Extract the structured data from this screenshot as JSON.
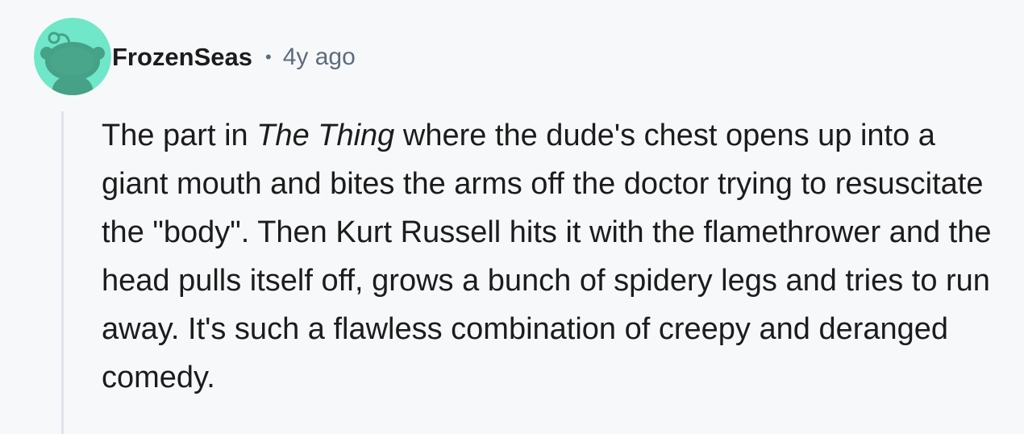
{
  "comment": {
    "author": "FrozenSeas",
    "separator": "•",
    "timestamp": "4y ago",
    "avatar": {
      "icon": "snoo-avatar-icon",
      "background_color": "#6fe7c8",
      "figure_color": "#46a186"
    },
    "body": {
      "prefix": "The part in ",
      "emphasis": "The Thing",
      "text": " where the dude's chest opens up into a giant mouth and bites the arms off the doctor trying to resuscitate the \"body\". Then Kurt Russell hits it with the flamethrower and the head pulls itself off, grows a bunch of spidery legs and tries to run away. It's such a flawless combination of creepy and deranged comedy."
    }
  }
}
